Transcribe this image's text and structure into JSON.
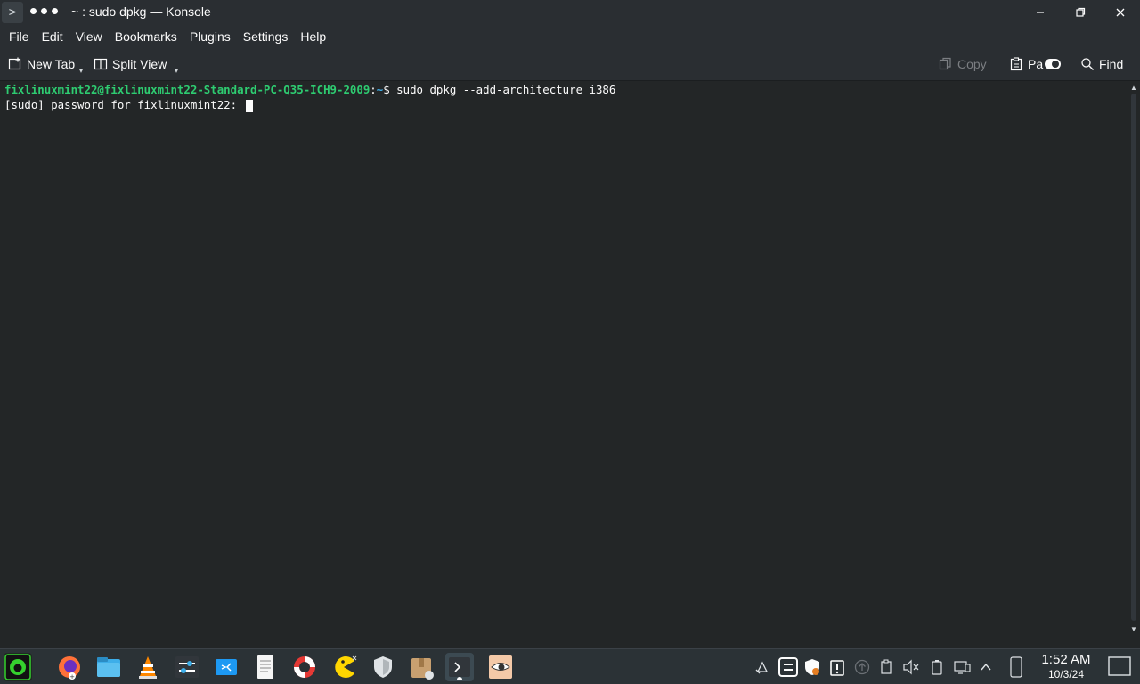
{
  "window": {
    "title": "~ : sudo dpkg — Konsole",
    "app_icon_glyph": ">"
  },
  "menu": [
    "File",
    "Edit",
    "View",
    "Bookmarks",
    "Plugins",
    "Settings",
    "Help"
  ],
  "toolbar": {
    "new_tab": "New Tab",
    "split_view": "Split View",
    "copy": "Copy",
    "paste": "Pa",
    "find": "Find"
  },
  "terminal": {
    "prompt_user": "fixlinuxmint22@fixlinuxmint22-Standard-PC-Q35-ICH9-2009",
    "prompt_sep": ":",
    "prompt_path": "~",
    "prompt_symbol": "$ ",
    "command": "sudo dpkg --add-architecture i386",
    "line2": "[sudo] password for fixlinuxmint22: "
  },
  "taskbar": {
    "clock_time": "1:52 AM",
    "clock_date": "10/3/24",
    "apps": [
      "menu",
      "firefox",
      "files",
      "vlc",
      "settings-manager",
      "transfer",
      "text-editor",
      "help",
      "pacman",
      "shield",
      "archive",
      "konsole",
      "eye"
    ]
  },
  "colors": {
    "background": "#232627",
    "chrome": "#2a2e32",
    "prompt_user": "#2ecc71",
    "prompt_path": "#3daee9"
  }
}
